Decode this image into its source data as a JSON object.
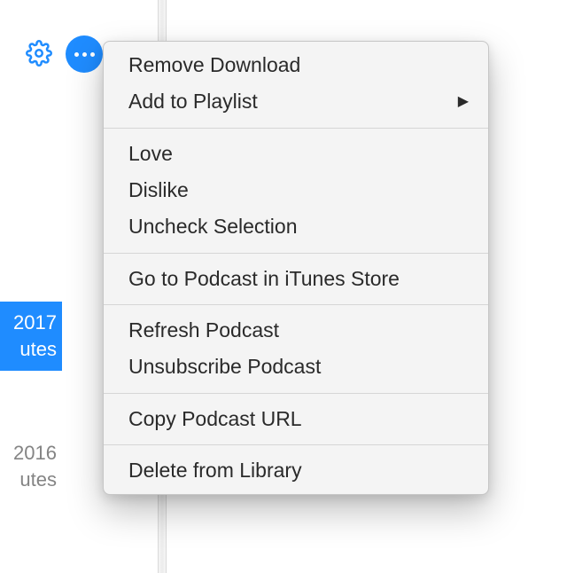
{
  "toolbar": {
    "gear_icon": "settings-gear",
    "more_icon": "more-horizontal"
  },
  "sidebar": {
    "selected": {
      "line1": "2017",
      "line2": "utes"
    },
    "other": {
      "line1": "2016",
      "line2": "utes"
    }
  },
  "context_menu": {
    "groups": [
      {
        "items": [
          {
            "label": "Remove Download",
            "has_submenu": false
          },
          {
            "label": "Add to Playlist",
            "has_submenu": true
          }
        ]
      },
      {
        "items": [
          {
            "label": "Love",
            "has_submenu": false
          },
          {
            "label": "Dislike",
            "has_submenu": false
          },
          {
            "label": "Uncheck Selection",
            "has_submenu": false
          }
        ]
      },
      {
        "items": [
          {
            "label": "Go to Podcast in iTunes Store",
            "has_submenu": false
          }
        ]
      },
      {
        "items": [
          {
            "label": "Refresh Podcast",
            "has_submenu": false
          },
          {
            "label": "Unsubscribe Podcast",
            "has_submenu": false
          }
        ]
      },
      {
        "items": [
          {
            "label": "Copy Podcast URL",
            "has_submenu": false
          }
        ]
      },
      {
        "items": [
          {
            "label": "Delete from Library",
            "has_submenu": false
          }
        ]
      }
    ]
  }
}
